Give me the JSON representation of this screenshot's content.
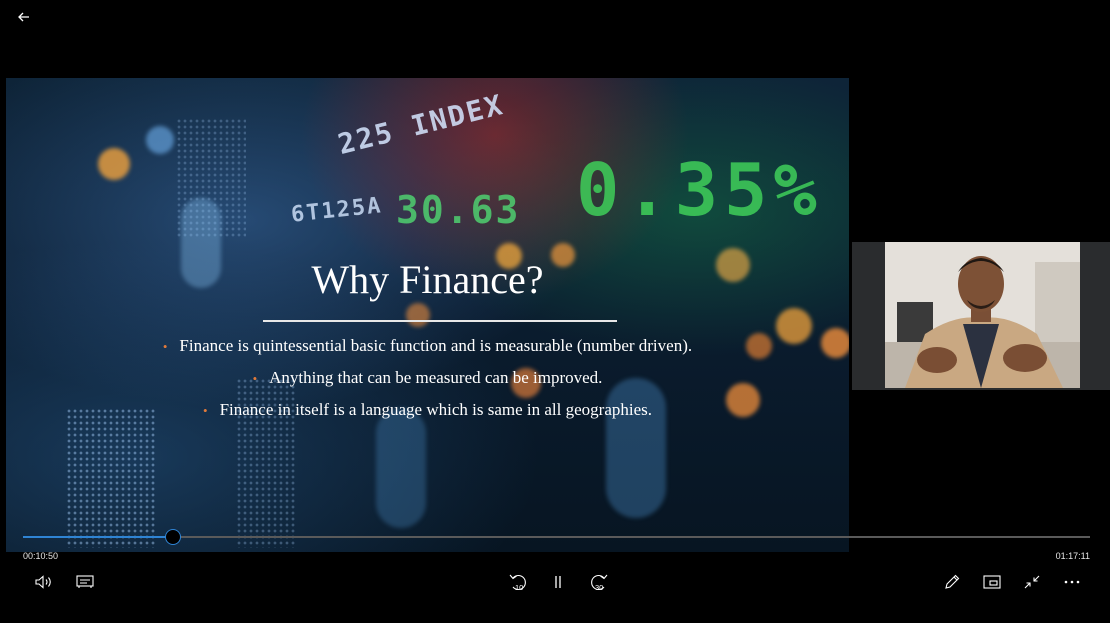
{
  "nav": {
    "back_icon": "arrow-left-icon"
  },
  "slide": {
    "title": "Why Finance?",
    "bullets": [
      "Finance is quintessential basic function and is measurable (number driven).",
      "Anything that can be measured can be improved.",
      "Finance in itself is a language which is same in all geographies."
    ],
    "background_text": {
      "index_label": "225 INDEX",
      "ticker_symbol": "6T125A",
      "ticker_value": "30.63",
      "percent_value": "0.35%"
    },
    "bullet_color": "#e07a3a"
  },
  "player": {
    "current_time": "00:10:50",
    "total_time": "01:17:11",
    "progress": 0.1404,
    "accent_color": "#2f84d4",
    "controls": {
      "volume_icon": "volume-icon",
      "captions_icon": "captions-icon",
      "skip_back_icon": "skip-back-10-icon",
      "skip_back_label": "10",
      "pause_icon": "pause-icon",
      "skip_forward_icon": "skip-forward-30-icon",
      "skip_forward_label": "30",
      "edit_icon": "pencil-icon",
      "miniview_icon": "mini-view-icon",
      "exit_fullscreen_icon": "exit-fullscreen-icon",
      "more_icon": "more-options-icon"
    }
  }
}
